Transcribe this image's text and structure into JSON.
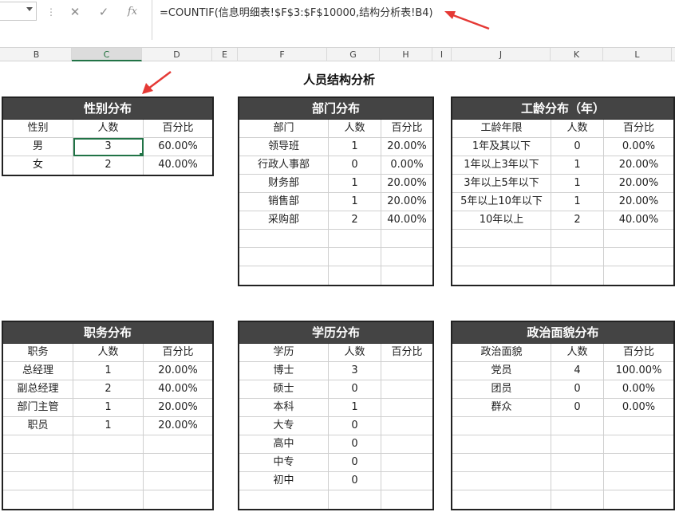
{
  "formula_bar": {
    "cancel_icon": "close-icon",
    "confirm_icon": "checkmark-icon",
    "fx_label": "fx",
    "formula": "=COUNTIF(信息明细表!$F$3:$F$10000,结构分析表!B4)"
  },
  "columns": [
    "B",
    "C",
    "D",
    "E",
    "F",
    "G",
    "H",
    "I",
    "J",
    "K",
    "L"
  ],
  "page_title": "人员结构分析",
  "accent_color": "#217346",
  "arrow_color": "#e53935",
  "tables": {
    "gender": {
      "title": "性别分布",
      "headers": [
        "性别",
        "人数",
        "百分比"
      ],
      "rows": [
        [
          "男",
          "3",
          "60.00%"
        ],
        [
          "女",
          "2",
          "40.00%"
        ]
      ]
    },
    "dept": {
      "title": "部门分布",
      "headers": [
        "部门",
        "人数",
        "百分比"
      ],
      "rows": [
        [
          "领导班",
          "1",
          "20.00%"
        ],
        [
          "行政人事部",
          "0",
          "0.00%"
        ],
        [
          "财务部",
          "1",
          "20.00%"
        ],
        [
          "销售部",
          "1",
          "20.00%"
        ],
        [
          "采购部",
          "2",
          "40.00%"
        ],
        [
          "",
          "",
          ""
        ],
        [
          "",
          "",
          ""
        ],
        [
          "",
          "",
          ""
        ]
      ]
    },
    "tenure": {
      "title": "工龄分布（年）",
      "headers": [
        "工龄年限",
        "人数",
        "百分比"
      ],
      "rows": [
        [
          "1年及其以下",
          "0",
          "0.00%"
        ],
        [
          "1年以上3年以下",
          "1",
          "20.00%"
        ],
        [
          "3年以上5年以下",
          "1",
          "20.00%"
        ],
        [
          "5年以上10年以下",
          "1",
          "20.00%"
        ],
        [
          "10年以上",
          "2",
          "40.00%"
        ],
        [
          "",
          "",
          ""
        ],
        [
          "",
          "",
          ""
        ],
        [
          "",
          "",
          ""
        ]
      ]
    },
    "position": {
      "title": "职务分布",
      "headers": [
        "职务",
        "人数",
        "百分比"
      ],
      "rows": [
        [
          "总经理",
          "1",
          "20.00%"
        ],
        [
          "副总经理",
          "2",
          "40.00%"
        ],
        [
          "部门主管",
          "1",
          "20.00%"
        ],
        [
          "职员",
          "1",
          "20.00%"
        ],
        [
          "",
          "",
          ""
        ],
        [
          "",
          "",
          ""
        ],
        [
          "",
          "",
          ""
        ],
        [
          "",
          "",
          ""
        ]
      ]
    },
    "education": {
      "title": "学历分布",
      "headers": [
        "学历",
        "人数",
        "百分比"
      ],
      "rows": [
        [
          "博士",
          "3",
          ""
        ],
        [
          "硕士",
          "0",
          ""
        ],
        [
          "本科",
          "1",
          ""
        ],
        [
          "大专",
          "0",
          ""
        ],
        [
          "高中",
          "0",
          ""
        ],
        [
          "中专",
          "0",
          ""
        ],
        [
          "初中",
          "0",
          ""
        ],
        [
          "",
          "",
          ""
        ]
      ]
    },
    "political": {
      "title": "政治面貌分布",
      "headers": [
        "政治面貌",
        "人数",
        "百分比"
      ],
      "rows": [
        [
          "党员",
          "4",
          "100.00%"
        ],
        [
          "团员",
          "0",
          "0.00%"
        ],
        [
          "群众",
          "0",
          "0.00%"
        ],
        [
          "",
          "",
          ""
        ],
        [
          "",
          "",
          ""
        ],
        [
          "",
          "",
          ""
        ],
        [
          "",
          "",
          ""
        ],
        [
          "",
          "",
          ""
        ]
      ]
    }
  }
}
